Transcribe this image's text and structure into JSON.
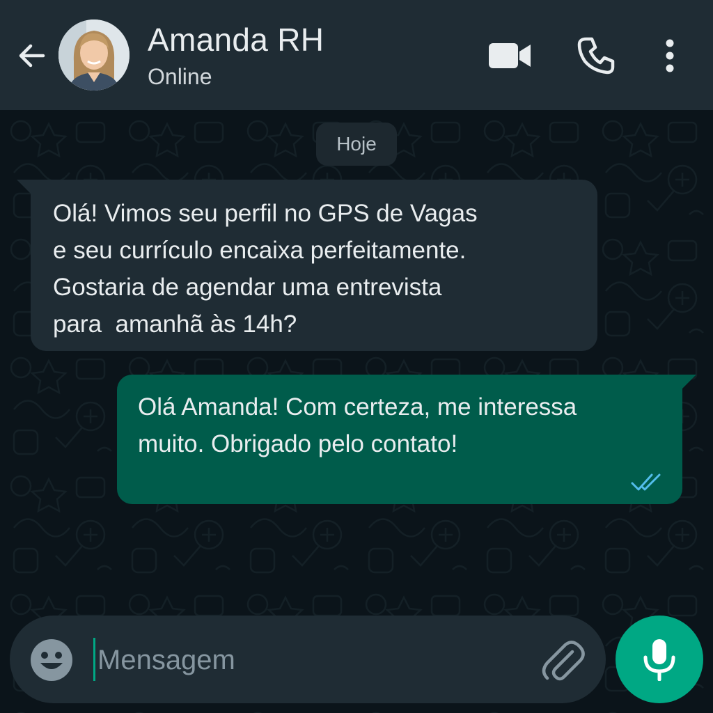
{
  "header": {
    "contact_name": "Amanda RH",
    "status": "Online"
  },
  "chat": {
    "date_label": "Hoje",
    "messages": [
      {
        "direction": "incoming",
        "text": "Olá! Vimos seu perfil no GPS de Vagas\ne seu currículo encaixa perfeitamente.\nGostaria de agendar uma entrevista\npara  amanhã às 14h?"
      },
      {
        "direction": "outgoing",
        "text": "Olá Amanda! Com certeza, me interessa\nmuito. Obrigado pelo contato!",
        "read_status": "read"
      }
    ]
  },
  "composer": {
    "placeholder": "Mensagem"
  },
  "icons": {
    "back": "arrow-left-icon",
    "video": "video-camera-icon",
    "call": "phone-icon",
    "menu": "more-vertical-icon",
    "emoji": "emoji-icon",
    "attach": "paperclip-icon",
    "mic": "microphone-icon"
  },
  "colors": {
    "header_bg": "#1f2c34",
    "chat_bg": "#0b141a",
    "incoming_bubble": "#1f2c34",
    "outgoing_bubble": "#005c4b",
    "accent": "#00a884",
    "read_ticks": "#53bdeb"
  }
}
